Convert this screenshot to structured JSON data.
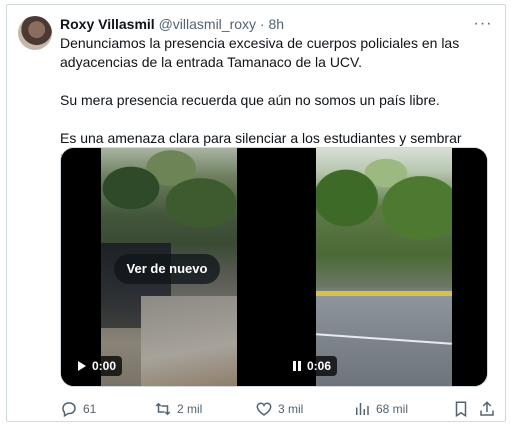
{
  "tweet": {
    "author_name": "Roxy Villasmil",
    "handle": "@villasmil_roxy",
    "time": "8h",
    "separator": "·",
    "more_label": "···",
    "paragraphs": [
      "Denunciamos la presencia excesiva de cuerpos policiales en las adyacencias de la entrada Tamanaco de la UCV.",
      "Su mera presencia recuerda que aún no somos un país libre.",
      "Es una amenaza clara para silenciar a los estudiantes y sembrar miedo."
    ]
  },
  "media": {
    "video1": {
      "replay_label": "Ver de nuevo",
      "time": "0:00",
      "control_icon": "play-icon"
    },
    "video2": {
      "time": "0:06",
      "control_icon": "pause-icon"
    }
  },
  "actions": {
    "replies": "61",
    "reposts": "2 mil",
    "likes": "3 mil",
    "views": "68 mil"
  },
  "colors": {
    "text": "#0f1419",
    "secondary": "#536471",
    "border": "#cfd9de"
  }
}
